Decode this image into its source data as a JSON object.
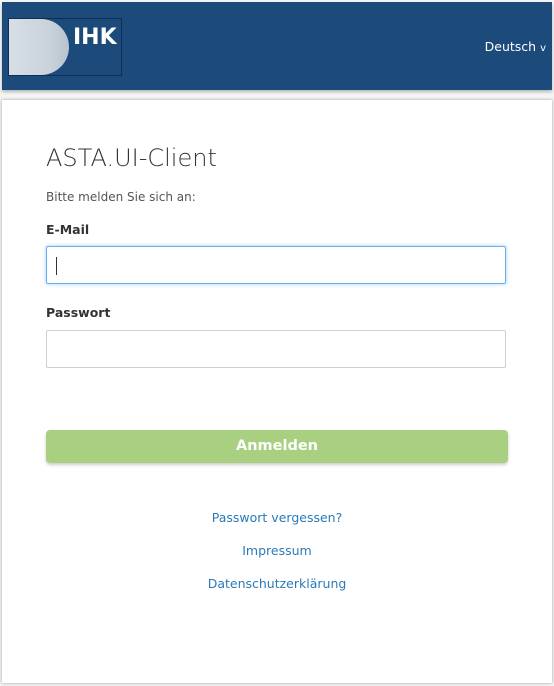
{
  "header": {
    "logo_text": "IHK",
    "language": "Deutsch",
    "language_chevron": "v"
  },
  "login": {
    "title": "ASTA.UI-Client",
    "subtitle": "Bitte melden Sie sich an:",
    "email_label": "E-Mail",
    "email_value": "",
    "password_label": "Passwort",
    "password_value": "",
    "submit_label": "Anmelden"
  },
  "links": {
    "forgot_password": "Passwort vergessen?",
    "imprint": "Impressum",
    "privacy": "Datenschutzerklärung"
  },
  "colors": {
    "header_bg": "#1c4a7a",
    "button_bg": "#a9cf80",
    "link": "#2a7ab8",
    "focus_border": "#66afe9"
  }
}
